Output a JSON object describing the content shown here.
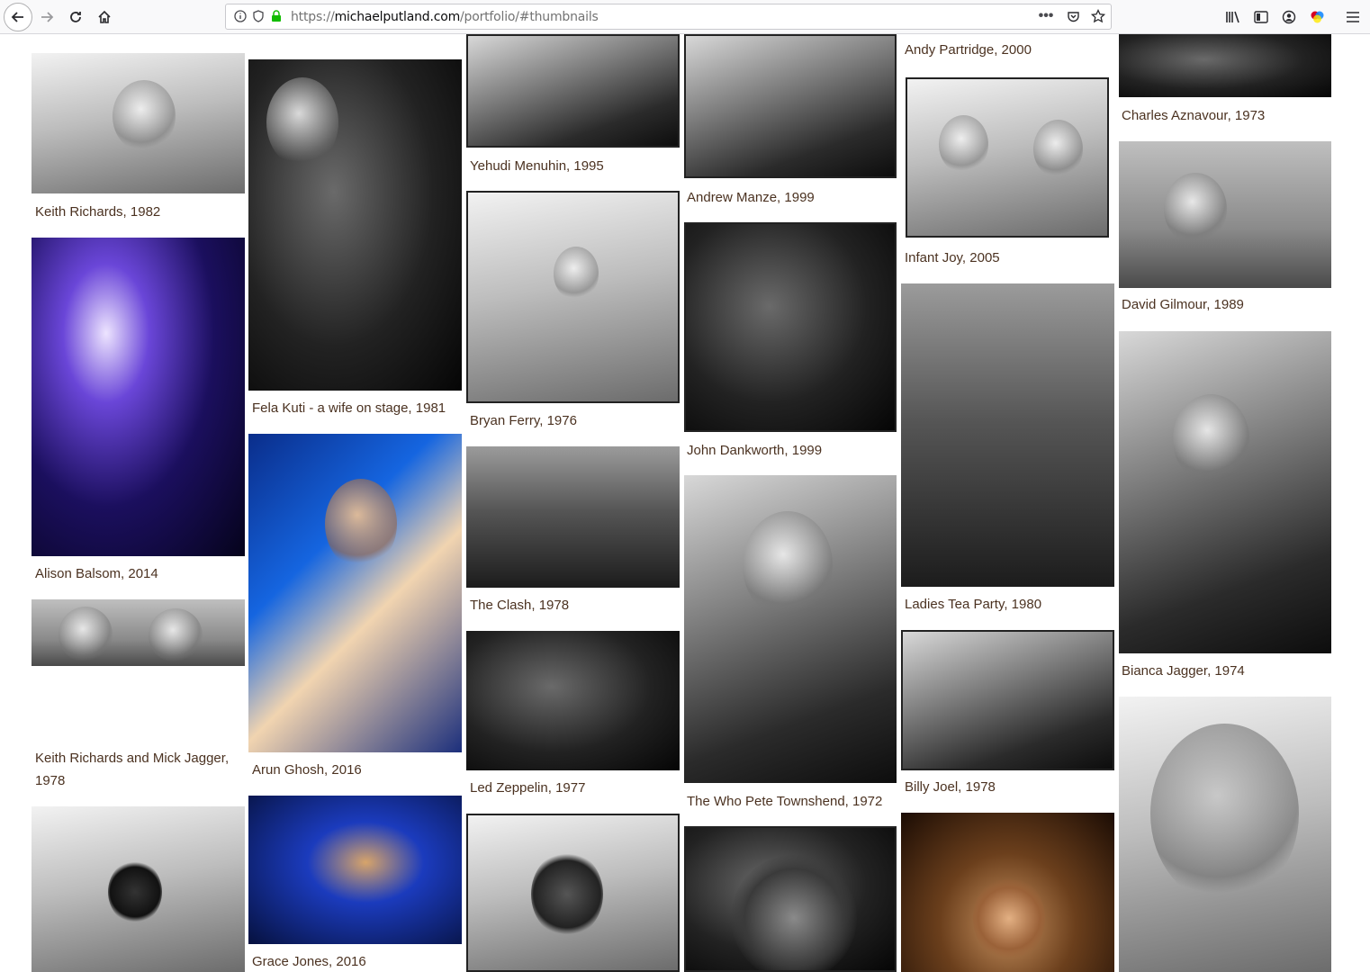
{
  "browser": {
    "url_host": "michaelputland.com",
    "url_prefix": "https://",
    "url_path": "/portfolio/#thumbnails",
    "icons": [
      "back-arrow-icon",
      "forward-arrow-icon",
      "reload-icon",
      "home-icon",
      "info-icon",
      "tracking-shield-icon",
      "lock-icon",
      "more-icon",
      "pocket-icon",
      "bookmark-star-icon",
      "library-icon",
      "sidebar-icon",
      "account-icon",
      "extensions-icon",
      "menu-icon"
    ]
  },
  "gallery": {
    "captions": {
      "keith_1982": "Keith Richards, 1982",
      "alison": "Alison Balsom, 2014",
      "keith_mick_1": "Keith Richards and Mick Jagger,",
      "keith_mick_2": "1978",
      "fela": "Fela Kuti - a wife on stage, 1981",
      "arun": "Arun Ghosh, 2016",
      "grace": "Grace Jones, 2016",
      "yehudi": "Yehudi Menuhin, 1995",
      "bryan": "Bryan Ferry, 1976",
      "clash": "The Clash, 1978",
      "zeppelin": "Led Zeppelin, 1977",
      "manze": "Andrew Manze, 1999",
      "dankworth": "John Dankworth, 1999",
      "who": "The Who Pete Townshend, 1972",
      "partridge": "Andy Partridge, 2000",
      "infant": "Infant Joy, 2005",
      "ladies": "Ladies Tea Party, 1980",
      "billy": "Billy Joel, 1978",
      "aznavour": "Charles Aznavour, 1973",
      "gilmour": "David Gilmour, 1989",
      "bianca": "Bianca Jagger, 1974"
    }
  }
}
